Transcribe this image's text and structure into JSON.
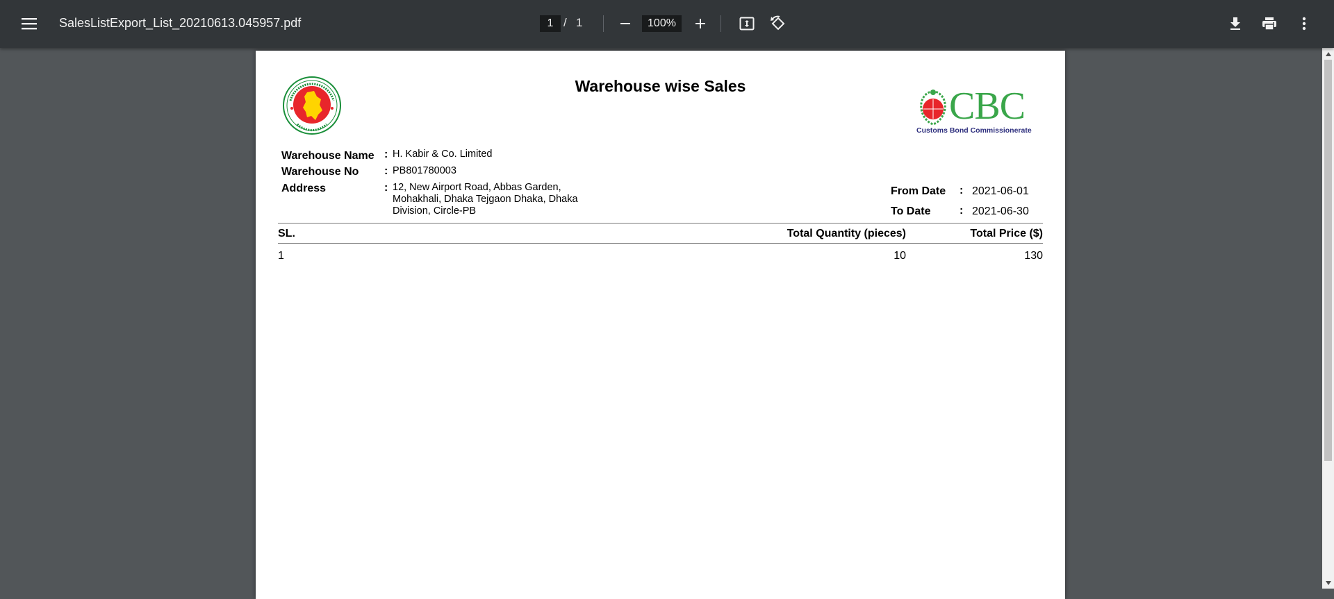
{
  "toolbar": {
    "file_name": "SalesListExport_List_20210613.045957.pdf",
    "current_page": "1",
    "page_separator": "/",
    "total_pages": "1",
    "zoom": "100%"
  },
  "document": {
    "title": "Warehouse wise Sales",
    "logo_left_name": "gov-seal-logo",
    "logo_right_text": "CBC",
    "logo_right_subtitle": "Customs Bond Commissionerate",
    "fields": {
      "warehouse_name_label": "Warehouse Name",
      "warehouse_name_value": "H. Kabir & Co. Limited",
      "warehouse_no_label": "Warehouse No",
      "warehouse_no_value": "PB801780003",
      "address_label": "Address",
      "address_line1": "12, New Airport Road, Abbas Garden,",
      "address_line2": "Mohakhali, Dhaka Tejgaon Dhaka, Dhaka",
      "address_line3": "Division, Circle-PB",
      "from_date_label": "From Date",
      "from_date_value": "2021-06-01",
      "to_date_label": "To Date",
      "to_date_value": "2021-06-30",
      "colon": ":"
    },
    "table": {
      "headers": [
        "SL.",
        "Total Quantity (pieces)",
        "Total Price ($)"
      ],
      "rows": [
        [
          "1",
          "10",
          "130"
        ]
      ]
    }
  },
  "colors": {
    "toolbar_bg": "#323639",
    "viewer_bg": "#525659",
    "cbc_green": "#3aa64a",
    "cbc_navy": "#2e2f7e",
    "seal_red": "#e8262b",
    "seal_green": "#1a8f3a"
  }
}
